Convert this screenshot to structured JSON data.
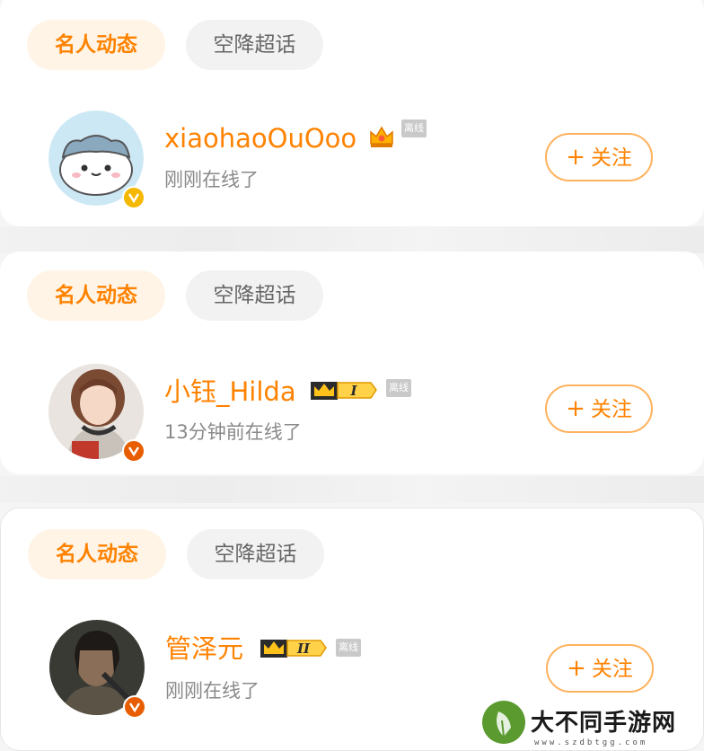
{
  "tabs": {
    "active_label": "名人动态",
    "inactive_label": "空降超话"
  },
  "follow_label": "关注",
  "follow_plus": "+",
  "offline_tag": "离线",
  "users": [
    {
      "name": "xiaohaoOuOoo",
      "status": "刚刚在线了",
      "verified_color": "#f5b800",
      "vip_level": ""
    },
    {
      "name": "小钰_Hilda",
      "status": "13分钟前在线了",
      "verified_color": "#e85d00",
      "vip_level": "I"
    },
    {
      "name": "管泽元",
      "status": "刚刚在线了",
      "verified_color": "#e85d00",
      "vip_level": "II"
    }
  ],
  "colors": {
    "accent": "#ff8200",
    "tab_active_bg": "#fff4e6",
    "tab_inactive_bg": "#f2f2f2",
    "follow_border": "#ffb25e"
  },
  "watermark": {
    "title": "大不同手游网",
    "url": "www.szdbtgg.com"
  }
}
